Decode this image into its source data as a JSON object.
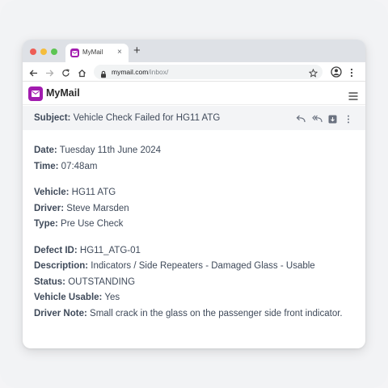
{
  "browser": {
    "tab_title": "MyMail",
    "tab_close": "×",
    "new_tab": "+",
    "url_host": "mymail.com",
    "url_path": "/inbox/"
  },
  "app": {
    "name": "MyMail",
    "brand_color": "#a21caf"
  },
  "email": {
    "subject_label": "Subject:",
    "subject": "Vehicle Check Failed for HG11 ATG",
    "date_label": "Date:",
    "date": "Tuesday 11th June 2024",
    "time_label": "Time:",
    "time": "07:48am",
    "vehicle_label": "Vehicle:",
    "vehicle": "HG11 ATG",
    "driver_label": "Driver:",
    "driver": "Steve Marsden",
    "type_label": "Type:",
    "type": "Pre Use Check",
    "defect_id_label": "Defect ID:",
    "defect_id": "HG11_ATG-01",
    "description_label": "Description:",
    "description": "Indicators / Side Repeaters - Damaged Glass - Usable",
    "status_label": "Status:",
    "status": "OUTSTANDING",
    "usable_label": "Vehicle Usable:",
    "usable": "Yes",
    "note_label": "Driver Note:",
    "note": "Small crack in the glass on the passenger side front indicator."
  },
  "icons": [
    "back-icon",
    "forward-icon",
    "reload-icon",
    "home-icon",
    "lock-icon",
    "star-icon",
    "profile-icon",
    "kebab-icon",
    "hamburger-icon",
    "reply-icon",
    "reply-all-icon",
    "archive-icon",
    "more-icon"
  ]
}
